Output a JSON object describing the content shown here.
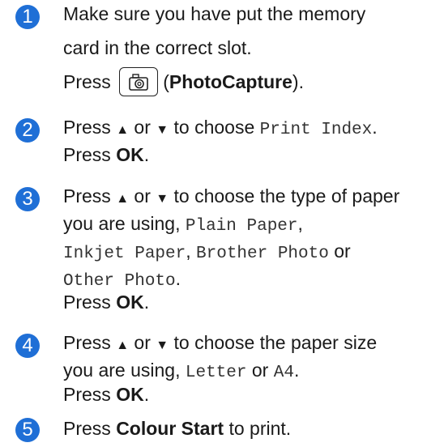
{
  "steps": [
    {
      "number": "1",
      "line1": "Make sure you have put the memory",
      "line2": "card in the correct slot.",
      "press_prefix": "Press",
      "photocapture": "PhotoCapture",
      "paren_open": "(",
      "paren_close": ")."
    },
    {
      "number": "2",
      "press": "Press",
      "up": "▲",
      "or": "or",
      "down": "▼",
      "to_choose": "to choose",
      "option": "Print Index",
      "period": ".",
      "press2": "Press",
      "ok": "OK",
      "period2": "."
    },
    {
      "number": "3",
      "line1_a": "Press",
      "up": "▲",
      "or": "or",
      "down": "▼",
      "line1_b": "to choose the type of paper",
      "line2_a": "you are using,",
      "plain": "Plain Paper",
      "comma": ",",
      "inkjet": "Inkjet Paper",
      "comma2": ",",
      "brother": "Brother Photo",
      "or2": "or",
      "other": "Other Photo",
      "period": ".",
      "press": "Press",
      "ok": "OK",
      "period2": "."
    },
    {
      "number": "4",
      "line1_a": "Press",
      "up": "▲",
      "or": "or",
      "down": "▼",
      "line1_b": "to choose the paper size",
      "line2_a": "you are using,",
      "letter": "Letter",
      "or2": "or",
      "a4": "A4",
      "period": ".",
      "press": "Press",
      "ok": "OK",
      "period2": "."
    },
    {
      "number": "5",
      "press": "Press",
      "colour_start": "Colour Start",
      "to_print": "to print."
    }
  ],
  "colors": {
    "badge": "#1f6fd6"
  },
  "icons": {
    "photocapture_button": "camera-icon"
  }
}
